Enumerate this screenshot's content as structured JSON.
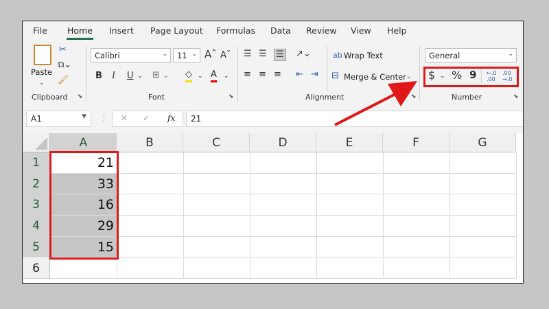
{
  "tabs": [
    "File",
    "Home",
    "Insert",
    "Page Layout",
    "Formulas",
    "Data",
    "Review",
    "View",
    "Help"
  ],
  "active_tab": "Home",
  "clipboard": {
    "paste": "Paste",
    "label": "Clipboard"
  },
  "font": {
    "name": "Calibri",
    "size": "11",
    "label": "Font",
    "bold": "B",
    "italic": "I",
    "underline": "U"
  },
  "alignment": {
    "wrap_text": "Wrap Text",
    "merge_center": "Merge & Center",
    "label": "Alignment"
  },
  "number": {
    "format": "General",
    "label": "Number",
    "currency": "$",
    "percent": "%",
    "comma": "9",
    "increase_decimal": "←.0 .00",
    "decrease_decimal": ".00 →.0"
  },
  "formula_bar": {
    "name_box": "A1",
    "cancel": "✕",
    "enter": "✓",
    "fx": "fx",
    "value": "21"
  },
  "columns": [
    "A",
    "B",
    "C",
    "D",
    "E",
    "F",
    "G"
  ],
  "rows": [
    {
      "n": "1",
      "a": "21"
    },
    {
      "n": "2",
      "a": "33"
    },
    {
      "n": "3",
      "a": "16"
    },
    {
      "n": "4",
      "a": "29"
    },
    {
      "n": "5",
      "a": "15"
    },
    {
      "n": "6",
      "a": ""
    }
  ],
  "colors": {
    "accent": "#217346",
    "highlight": "#e01818",
    "selection": "#c6c6c6"
  }
}
